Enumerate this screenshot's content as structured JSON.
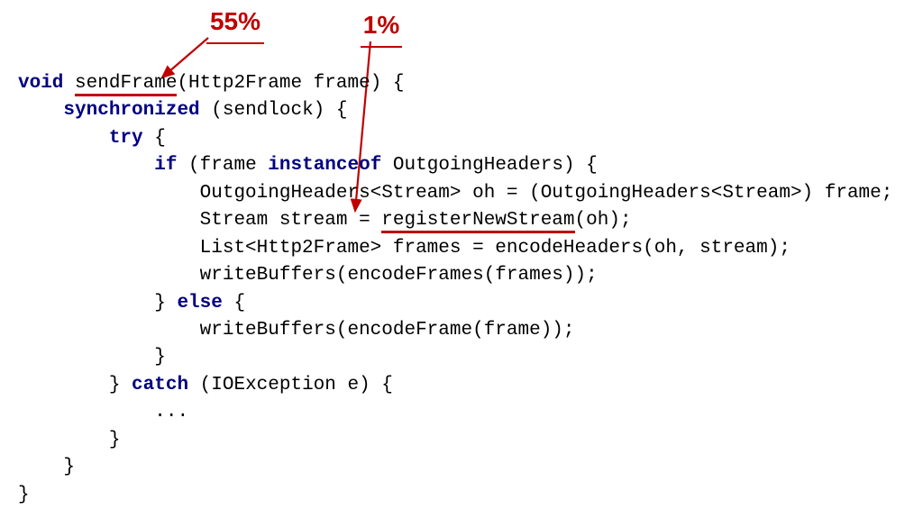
{
  "annotations": {
    "pct55": "55%",
    "pct1": "1%"
  },
  "code": {
    "l1_kw1": "void",
    "l1_fn": "sendFrame",
    "l1_rest": "(Http2Frame frame) {",
    "l2_kw": "synchronized",
    "l2_rest": " (sendlock) {",
    "l3_kw": "try",
    "l3_rest": " {",
    "l4_kw1": "if",
    "l4_mid": " (frame ",
    "l4_kw2": "instanceof",
    "l4_rest": " OutgoingHeaders) {",
    "l5": "OutgoingHeaders<Stream> oh = (OutgoingHeaders<Stream>) frame;",
    "l6_a": "Stream stream = ",
    "l6_fn": "registerNewStream",
    "l6_b": "(oh);",
    "l7": "List<Http2Frame> frames = encodeHeaders(oh, stream);",
    "l8": "writeBuffers(encodeFrames(frames));",
    "l9_a": "} ",
    "l9_kw": "else",
    "l9_b": " {",
    "l10": "writeBuffers(encodeFrame(frame));",
    "l11": "}",
    "l12_a": "} ",
    "l12_kw": "catch",
    "l12_b": " (IOException e) {",
    "l13": "...",
    "l14": "}",
    "l15": "}",
    "l16": "}"
  },
  "colors": {
    "keyword": "#000080",
    "annotation": "#c00000"
  }
}
